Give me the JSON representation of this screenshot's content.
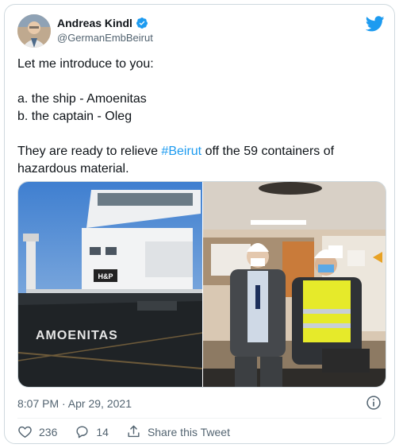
{
  "author": {
    "name": "Andreas Kindl",
    "handle": "@GermanEmbBeirut"
  },
  "tweet": {
    "line1": "Let me introduce to you:",
    "line2": "a. the ship - Amoenitas",
    "line3": "b. the captain - Oleg",
    "line4_pre": "They are ready to relieve ",
    "hashtag": "#Beirut",
    "line4_post": " off the 59 containers of hazardous material."
  },
  "media": {
    "ship_name_on_hull": "AMOENITAS",
    "ship_sign": "H&P"
  },
  "meta": {
    "timestamp": "8:07 PM · Apr 29, 2021"
  },
  "actions": {
    "likes": "236",
    "replies": "14",
    "share_label": "Share this Tweet"
  },
  "colors": {
    "accent": "#1d9bf0",
    "text": "#0f1419",
    "muted": "#536471",
    "border": "#cfd9de"
  }
}
